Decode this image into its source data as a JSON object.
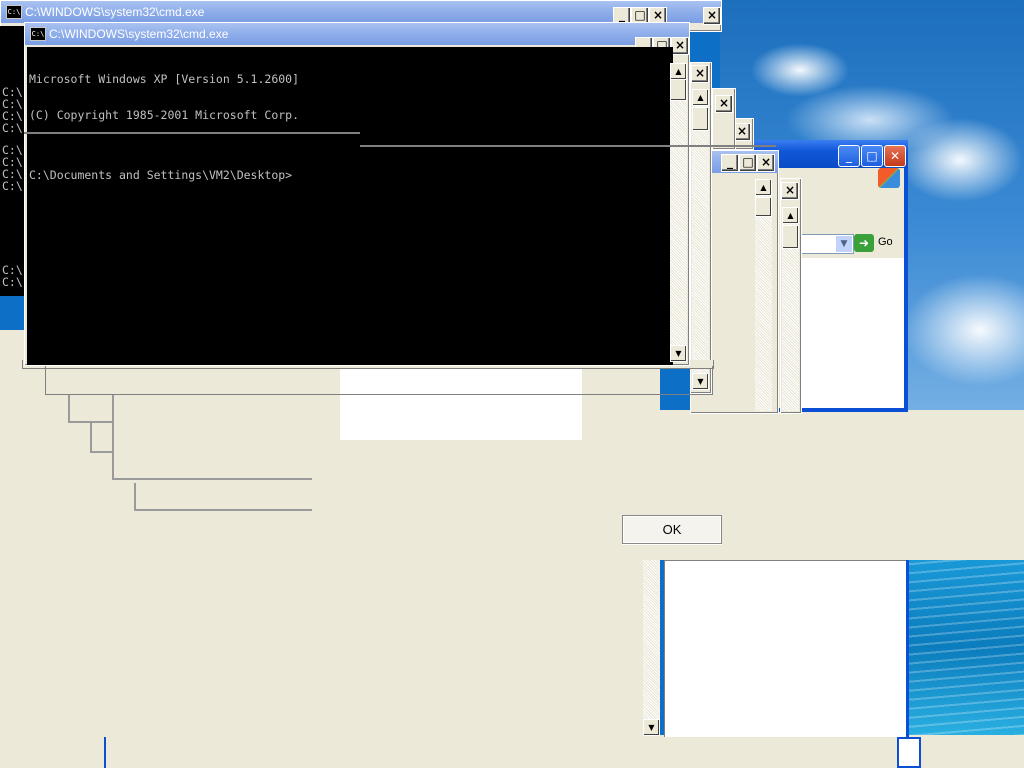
{
  "windows": {
    "cmd_front": {
      "title": "C:\\WINDOWS\\system32\\cmd.exe",
      "icon_label": "C:\\",
      "console_lines": [
        "Microsoft Windows XP [Version 5.1.2600]",
        "(C) Copyright 1985-2001 Microsoft Corp.",
        "",
        "C:\\Documents and Settings\\VM2\\Desktop>"
      ]
    },
    "cmd_back": {
      "title": "C:\\WINDOWS\\system32\\cmd.exe",
      "icon_label": "C:\\"
    },
    "left_prompts": [
      "C:\\",
      "C:\\",
      "C:\\",
      "C:\\",
      "C:\\",
      "C:\\",
      "C:\\",
      "C:\\",
      "C:\\",
      "C:\\"
    ],
    "caption": {
      "minimize": "_",
      "maximize": "□",
      "close": "×"
    },
    "explorer": {
      "go_label": "Go",
      "address_value": ""
    }
  },
  "dialog": {
    "ok_label": "OK"
  },
  "colors": {
    "xp_blue": "#0a4fd4",
    "face": "#ece9d8",
    "console_bg": "#000000",
    "console_fg": "#c0c0c0"
  }
}
